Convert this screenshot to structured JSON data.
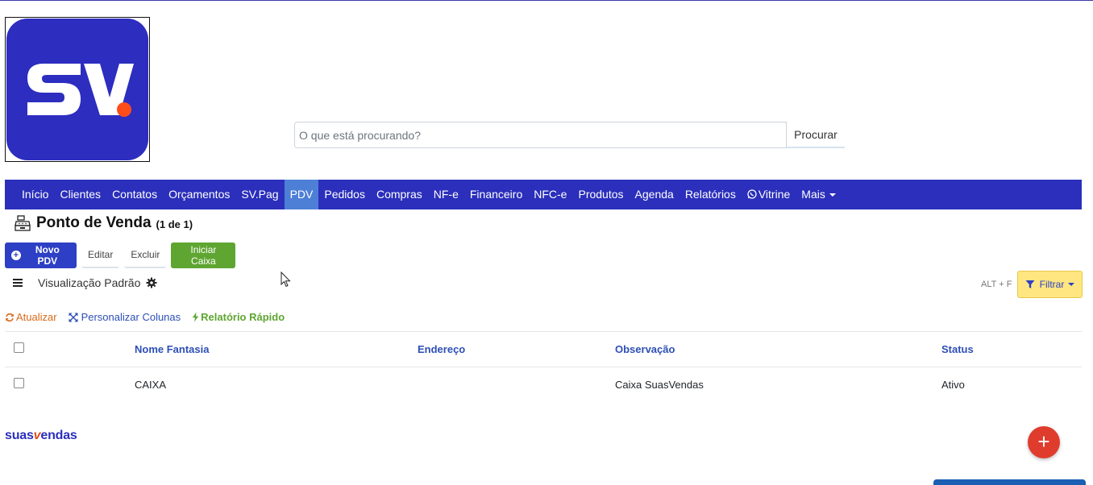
{
  "logo": {
    "text": "SV",
    "accent_color": "#ff4d1a",
    "bg_color": "#2d2dc0"
  },
  "search": {
    "placeholder": "O que está procurando?",
    "value": "",
    "button_label": "Procurar"
  },
  "nav": {
    "items": [
      {
        "label": "Início",
        "active": false
      },
      {
        "label": "Clientes",
        "active": false
      },
      {
        "label": "Contatos",
        "active": false
      },
      {
        "label": "Orçamentos",
        "active": false
      },
      {
        "label": "SV.Pag",
        "active": false
      },
      {
        "label": "PDV",
        "active": true
      },
      {
        "label": "Pedidos",
        "active": false
      },
      {
        "label": "Compras",
        "active": false
      },
      {
        "label": "NF-e",
        "active": false
      },
      {
        "label": "Financeiro",
        "active": false
      },
      {
        "label": "NFC-e",
        "active": false
      },
      {
        "label": "Produtos",
        "active": false
      },
      {
        "label": "Agenda",
        "active": false
      },
      {
        "label": "Relatórios",
        "active": false
      },
      {
        "label": "Vitrine",
        "active": false,
        "icon": "whatsapp-icon"
      },
      {
        "label": "Mais",
        "active": false,
        "dropdown": true
      }
    ]
  },
  "page": {
    "title": "Ponto de Venda",
    "count": "(1 de 1)",
    "icon": "cash-register-icon"
  },
  "toolbar": {
    "new_label": "Novo PDV",
    "edit_label": "Editar",
    "delete_label": "Excluir",
    "start_label": "Iniciar Caixa"
  },
  "view": {
    "label": "Visualização Padrão"
  },
  "filter": {
    "shortcut": "ALT + F",
    "label": "Filtrar"
  },
  "actions": {
    "refresh": "Atualizar",
    "columns": "Personalizar Colunas",
    "report": "Relatório Rápido"
  },
  "table": {
    "headers": [
      "Nome Fantasia",
      "Endereço",
      "Observação",
      "Status"
    ],
    "rows": [
      {
        "nome": "CAIXA",
        "endereco": "",
        "observacao": "Caixa SuasVendas",
        "status": "Ativo"
      }
    ]
  },
  "brand": {
    "part1": "suas",
    "part2": "v",
    "part3": "endas"
  },
  "fab": {
    "label": "+"
  },
  "colors": {
    "primary": "#2b2fbb",
    "active_nav": "#4d7fd6",
    "success": "#5fa532",
    "filter": "#ffe680",
    "fab": "#e03c2e"
  }
}
